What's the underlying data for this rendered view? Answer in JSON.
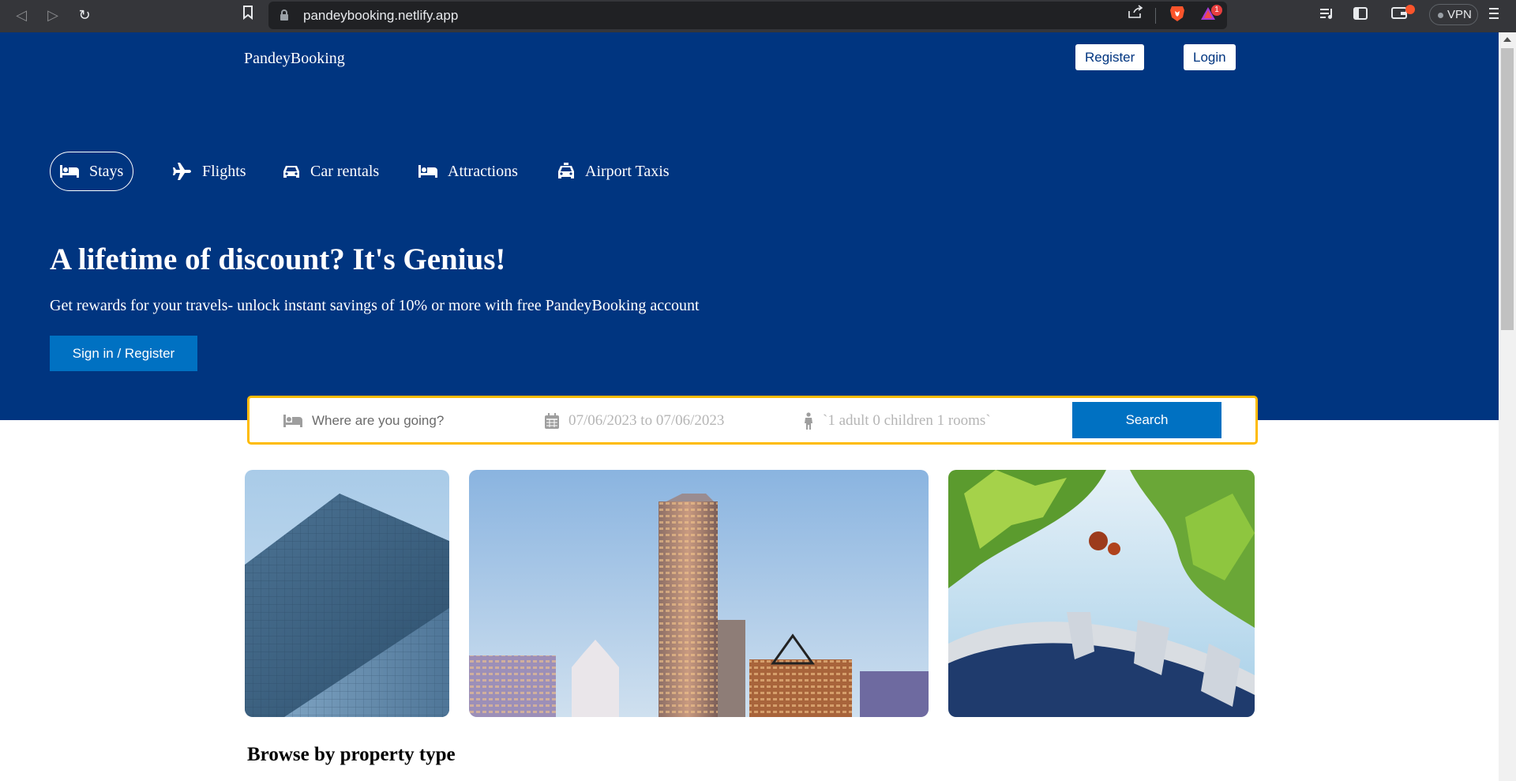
{
  "browser": {
    "url": "pandeybooking.netlify.app",
    "vpn_label": "VPN",
    "notification_count": "1"
  },
  "header": {
    "logo": "PandeyBooking",
    "register_label": "Register",
    "login_label": "Login"
  },
  "tabs": [
    {
      "label": "Stays",
      "icon": "bed-icon",
      "active": true
    },
    {
      "label": "Flights",
      "icon": "plane-icon",
      "active": false
    },
    {
      "label": "Car rentals",
      "icon": "car-icon",
      "active": false
    },
    {
      "label": "Attractions",
      "icon": "bed-icon",
      "active": false
    },
    {
      "label": "Airport Taxis",
      "icon": "taxi-icon",
      "active": false
    }
  ],
  "hero": {
    "title": "A lifetime of discount? It's Genius!",
    "description": "Get rewards for your travels- unlock instant savings of 10% or more with free PandeyBooking account",
    "cta_label": "Sign in / Register"
  },
  "search": {
    "destination_placeholder": "Where are you going?",
    "date_range": "07/06/2023 to 07/06/2023",
    "guests": "`1 adult 0 children 1 rooms`",
    "button_label": "Search"
  },
  "featured": [
    {
      "name": "featured-image-glass-building"
    },
    {
      "name": "featured-image-city-skyline"
    },
    {
      "name": "featured-image-reno-arch"
    }
  ],
  "sections": {
    "browse_title": "Browse by property type"
  },
  "colors": {
    "brand": "#003580",
    "accent": "#0071c2",
    "search_border": "#febb02"
  }
}
